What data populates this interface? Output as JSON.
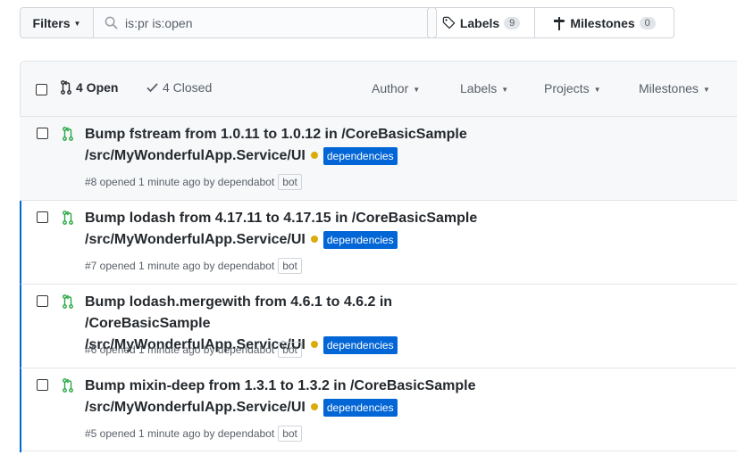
{
  "toolbar": {
    "filters_label": "Filters",
    "search_value": "is:pr is:open",
    "labels_label": "Labels",
    "labels_count": "9",
    "milestones_label": "Milestones",
    "milestones_count": "0"
  },
  "list_header": {
    "open_label": "4 Open",
    "closed_label": "4 Closed",
    "menus": [
      "Author",
      "Labels",
      "Projects",
      "Milestones"
    ]
  },
  "pull_requests": [
    {
      "title_line1": "Bump fstream from 1.0.11 to 1.0.12 in /CoreBasicSample",
      "title_line2": "/src/MyWonderfulApp.Service/UI",
      "label": "dependencies",
      "meta": "#8 opened 1 minute ago by dependabot",
      "badge": "bot"
    },
    {
      "title_line1": "Bump lodash from 4.17.11 to 4.17.15 in /CoreBasicSample",
      "title_line2": "/src/MyWonderfulApp.Service/UI",
      "label": "dependencies",
      "meta": "#7 opened 1 minute ago by dependabot",
      "badge": "bot"
    },
    {
      "title_line1": "Bump lodash.mergewith from 4.6.1 to 4.6.2 in /CoreBasicSample",
      "title_line2": "/src/MyWonderfulApp.Service/UI",
      "label": "dependencies",
      "meta": "#6 opened 1 minute ago by dependabot",
      "badge": "bot"
    },
    {
      "title_line1": "Bump mixin-deep from 1.3.1 to 1.3.2 in /CoreBasicSample",
      "title_line2": "/src/MyWonderfulApp.Service/UI",
      "label": "dependencies",
      "meta": "#5 opened 1 minute ago by dependabot",
      "badge": "bot"
    }
  ],
  "colors": {
    "pr_open_green": "#28a745",
    "label_blue": "#0366d6",
    "status_pending": "#dbab09",
    "active_border": "#0366d6"
  },
  "icons": {
    "search": "search-icon",
    "labels": "tag-icon",
    "milestones": "milestone-icon",
    "pr": "git-pull-request-icon",
    "check": "check-icon"
  }
}
